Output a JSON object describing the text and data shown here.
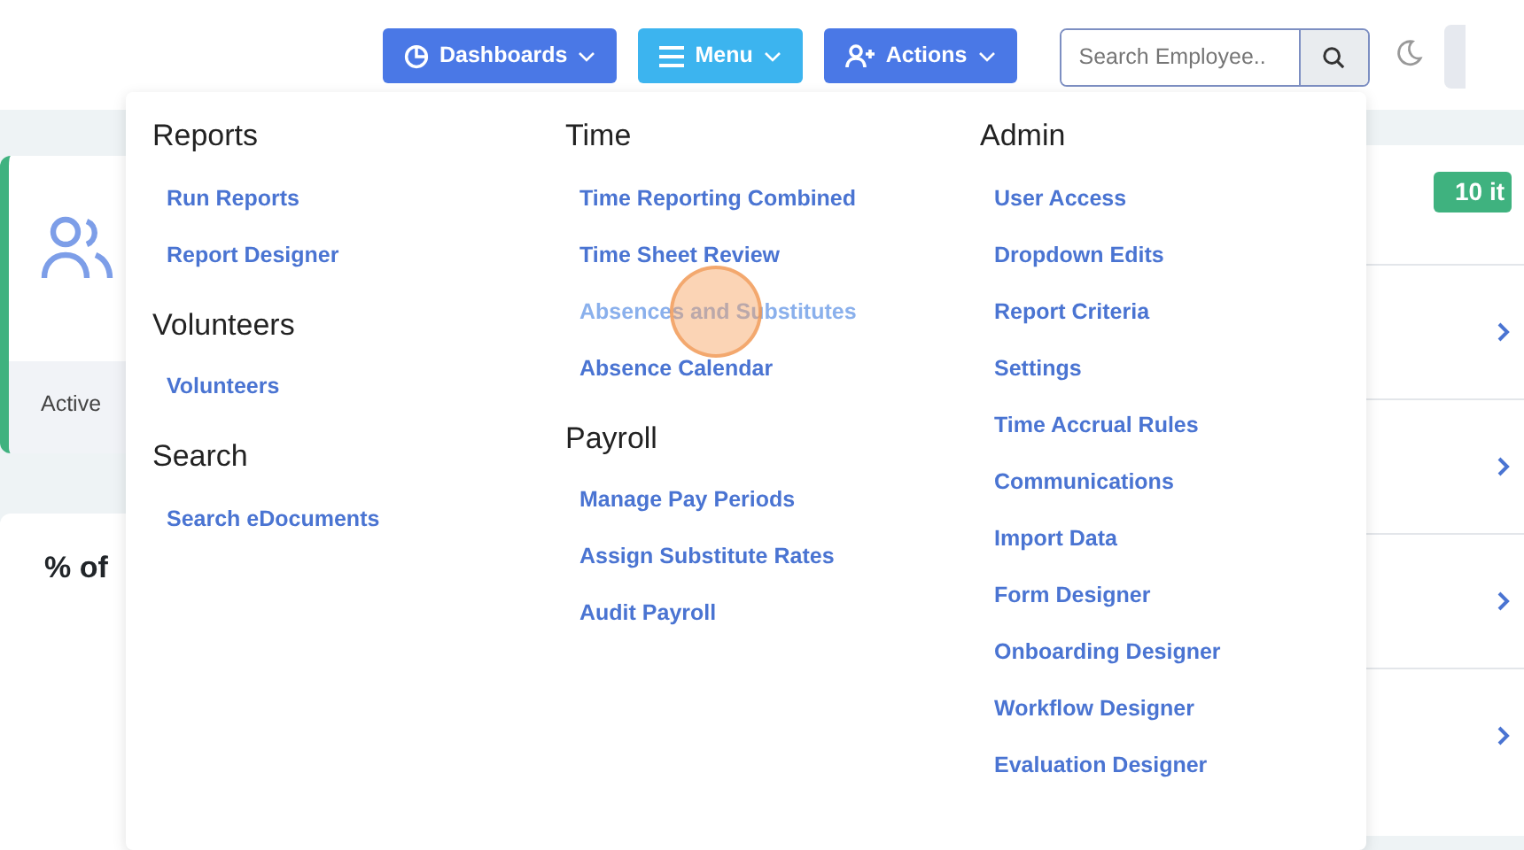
{
  "navbar": {
    "buttons": [
      {
        "label": "Dashboards",
        "kind": "chart",
        "expanded": false
      },
      {
        "label": "Menu",
        "kind": "menu",
        "expanded": true
      },
      {
        "label": "Actions",
        "kind": "user-plus",
        "expanded": false
      }
    ],
    "search": {
      "placeholder": "Search Employee.."
    }
  },
  "background": {
    "stat_card": {
      "caption": "Active"
    },
    "chart_card": {
      "title": "% of"
    },
    "list_card": {
      "badge": "10 it"
    }
  },
  "menu": {
    "columns": [
      {
        "sections": [
          {
            "title": "Reports",
            "items": [
              {
                "label": "Run Reports",
                "hovered": false
              },
              {
                "label": "Report Designer",
                "hovered": false
              }
            ]
          },
          {
            "title": "Volunteers",
            "items": [
              {
                "label": "Volunteers",
                "hovered": false
              }
            ]
          },
          {
            "title": "Search",
            "items": [
              {
                "label": "Search eDocuments",
                "hovered": false
              }
            ]
          }
        ]
      },
      {
        "sections": [
          {
            "title": "Time",
            "items": [
              {
                "label": "Time Reporting Combined",
                "hovered": false
              },
              {
                "label": "Time Sheet Review",
                "hovered": false
              },
              {
                "label": "Absences and Substitutes",
                "hovered": true
              },
              {
                "label": "Absence Calendar",
                "hovered": false
              }
            ]
          },
          {
            "title": "Payroll",
            "items": [
              {
                "label": "Manage Pay Periods",
                "hovered": false
              },
              {
                "label": "Assign Substitute Rates",
                "hovered": false
              },
              {
                "label": "Audit Payroll",
                "hovered": false
              }
            ]
          }
        ]
      },
      {
        "sections": [
          {
            "title": "Admin",
            "items": [
              {
                "label": "User Access",
                "hovered": false
              },
              {
                "label": "Dropdown Edits",
                "hovered": false
              },
              {
                "label": "Report Criteria",
                "hovered": false
              },
              {
                "label": "Settings",
                "hovered": false
              },
              {
                "label": "Time Accrual Rules",
                "hovered": false
              },
              {
                "label": "Communications",
                "hovered": false
              },
              {
                "label": "Import Data",
                "hovered": false
              },
              {
                "label": "Form Designer",
                "hovered": false
              },
              {
                "label": "Onboarding Designer",
                "hovered": false
              },
              {
                "label": "Workflow Designer",
                "hovered": false
              },
              {
                "label": "Evaluation Designer",
                "hovered": false
              }
            ]
          }
        ]
      }
    ]
  }
}
